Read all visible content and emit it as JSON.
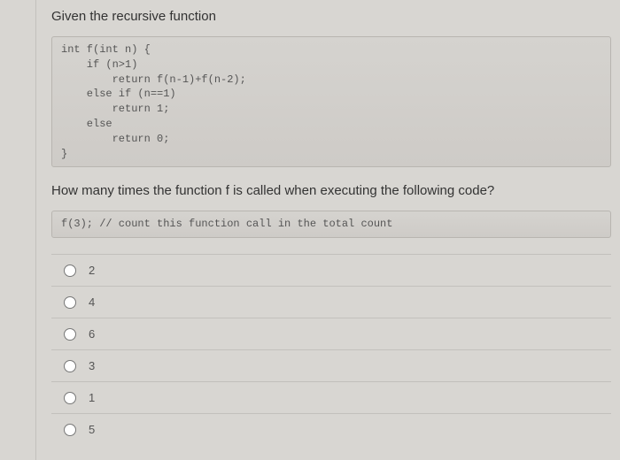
{
  "question": {
    "intro": "Given the recursive function",
    "code1": "int f(int n) {\n    if (n>1)\n        return f(n-1)+f(n-2);\n    else if (n==1)\n        return 1;\n    else\n        return 0;\n}",
    "prompt": "How many times the function f is called when executing the following code?",
    "code2": "f(3); // count this function call in the total count"
  },
  "options": [
    {
      "label": "2"
    },
    {
      "label": "4"
    },
    {
      "label": "6"
    },
    {
      "label": "3"
    },
    {
      "label": "1"
    },
    {
      "label": "5"
    }
  ]
}
